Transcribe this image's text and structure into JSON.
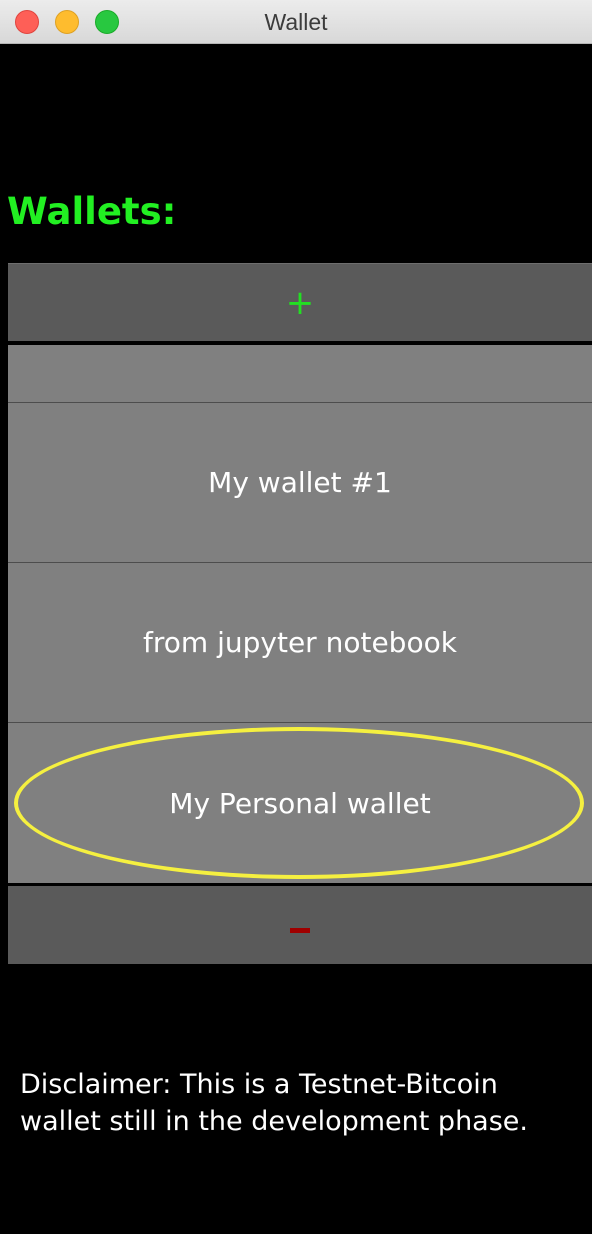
{
  "window": {
    "title": "Wallet",
    "controls": [
      "close",
      "minimize",
      "zoom"
    ]
  },
  "wallets_heading": "Wallets:",
  "add_button": {
    "label": "+",
    "icon": "plus-icon",
    "color": "#22e022"
  },
  "wallets": [
    {
      "name": "My wallet #1",
      "highlighted": false
    },
    {
      "name": "from jupyter notebook",
      "highlighted": false
    },
    {
      "name": "My Personal wallet",
      "highlighted": true
    }
  ],
  "remove_button": {
    "icon": "minus-icon",
    "color": "#a00000"
  },
  "disclaimer": "Disclaimer: This is a Testnet-Bitcoin wallet still in the development phase.",
  "colors": {
    "background": "#000000",
    "heading": "#22f022",
    "list_item": "#808080",
    "button": "#5a5a5a",
    "highlight_ring": "#f5f040"
  }
}
